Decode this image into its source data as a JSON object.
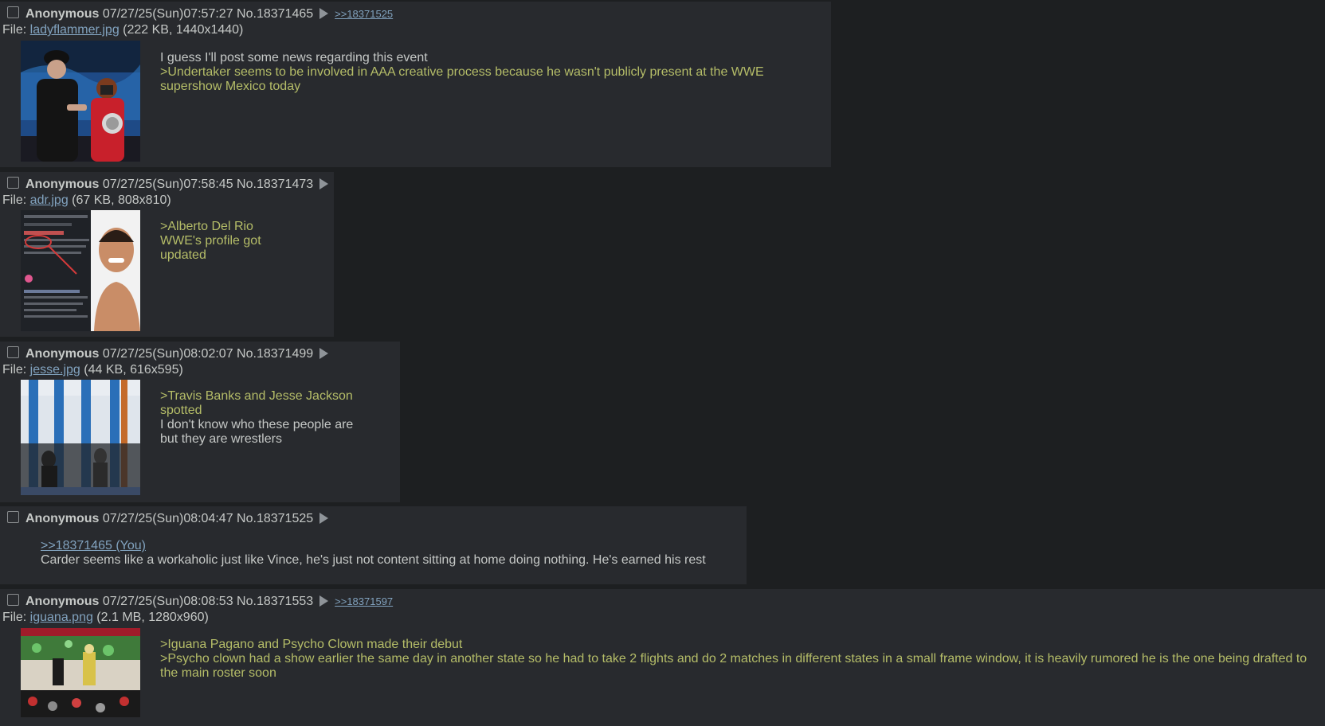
{
  "posts": [
    {
      "name": "Anonymous",
      "date": "07/27/25(Sun)07:57:27",
      "postno": "No.18371465",
      "backlink": ">>18371525",
      "file_label": "File: ",
      "file_name": "ladyflammer.jpg",
      "file_info": " (222 KB, 1440x1440)",
      "lines": [
        {
          "type": "text",
          "value": "I guess I'll post some news regarding this event"
        },
        {
          "type": "quote",
          "value": ">Undertaker seems to be involved in AAA creative process because he wasn't publicly present at the WWE supershow Mexico today"
        }
      ]
    },
    {
      "name": "Anonymous",
      "date": "07/27/25(Sun)07:58:45",
      "postno": "No.18371473",
      "file_label": "File: ",
      "file_name": "adr.jpg",
      "file_info": " (67 KB, 808x810)",
      "lines": [
        {
          "type": "quote",
          "value": ">Alberto Del Rio WWE's profile got updated"
        }
      ]
    },
    {
      "name": "Anonymous",
      "date": "07/27/25(Sun)08:02:07",
      "postno": "No.18371499",
      "file_label": "File: ",
      "file_name": "jesse.jpg",
      "file_info": " (44 KB, 616x595)",
      "lines": [
        {
          "type": "quote",
          "value": ">Travis Banks and Jesse Jackson spotted"
        },
        {
          "type": "text",
          "value": "I don't know who these people are but they are wrestlers"
        }
      ]
    },
    {
      "name": "Anonymous",
      "date": "07/27/25(Sun)08:04:47",
      "postno": "No.18371525",
      "lines": [
        {
          "type": "quotelink",
          "value": ">>18371465 (You)"
        },
        {
          "type": "text",
          "value": "Carder seems like a workaholic just like Vince, he's just not content sitting at home doing nothing. He's earned his rest"
        }
      ]
    },
    {
      "name": "Anonymous",
      "date": "07/27/25(Sun)08:08:53",
      "postno": "No.18371553",
      "backlink": ">>18371597",
      "file_label": "File: ",
      "file_name": "iguana.png",
      "file_info": " (2.1 MB, 1280x960)",
      "lines": [
        {
          "type": "quote",
          "value": ">Iguana Pagano and Psycho Clown made their debut"
        },
        {
          "type": "quote",
          "value": ">Psycho clown had a show earlier the same day in another state so he had to take 2 flights and do 2 matches in different states in a small frame window, it is heavily rumored he is the one being drafted to the main roster soon"
        }
      ]
    }
  ],
  "icons": {
    "post_menu": "triangle-right-icon",
    "select": "checkbox"
  },
  "colors": {
    "background": "#1d1f21",
    "post_background": "#282a2e",
    "text": "#c5c8c6",
    "greentext": "#b5bd68",
    "link": "#81a2be"
  }
}
